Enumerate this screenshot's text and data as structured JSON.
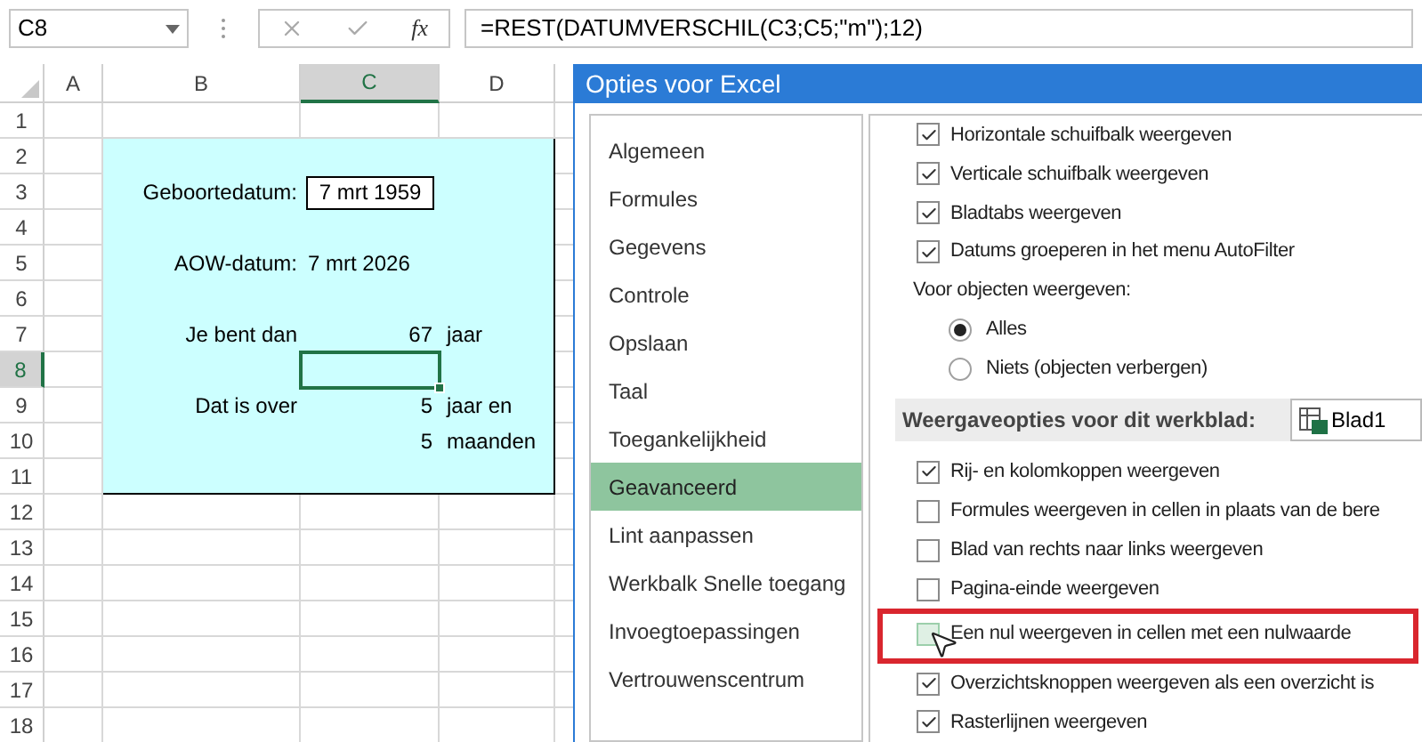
{
  "formula_bar": {
    "name_box": "C8",
    "function_button": "fx",
    "formula": "=REST(DATUMVERSCHIL(C3;C5;\"m\");12)"
  },
  "sheet": {
    "columns": [
      {
        "label": "A",
        "selected": false
      },
      {
        "label": "B",
        "selected": false
      },
      {
        "label": "C",
        "selected": true
      },
      {
        "label": "D",
        "selected": false
      }
    ],
    "rows": [
      {
        "header": "1",
        "selected": false,
        "cells": {}
      },
      {
        "header": "2",
        "selected": false,
        "cells": {}
      },
      {
        "header": "3",
        "selected": false,
        "cells": {
          "B": {
            "text": "Geboortedatum:",
            "kind": "label"
          },
          "C": {
            "text": "7 mrt 1959",
            "kind": "date",
            "boxed": true
          }
        }
      },
      {
        "header": "4",
        "selected": false,
        "cells": {}
      },
      {
        "header": "5",
        "selected": false,
        "cells": {
          "B": {
            "text": "AOW-datum:",
            "kind": "label"
          },
          "C": {
            "text": "7 mrt 2026",
            "kind": "date",
            "boxed": false
          }
        }
      },
      {
        "header": "6",
        "selected": false,
        "cells": {}
      },
      {
        "header": "7",
        "selected": false,
        "cells": {
          "B": {
            "text": "Je bent dan",
            "kind": "label"
          },
          "C": {
            "text": "67",
            "kind": "number"
          },
          "D": {
            "text": "jaar",
            "kind": "unit"
          }
        }
      },
      {
        "header": "8",
        "selected": true,
        "cells": {}
      },
      {
        "header": "9",
        "selected": false,
        "cells": {
          "B": {
            "text": "Dat is over",
            "kind": "label"
          },
          "C": {
            "text": "5",
            "kind": "number"
          },
          "D": {
            "text": "jaar en",
            "kind": "unit"
          }
        }
      },
      {
        "header": "10",
        "selected": false,
        "cells": {
          "C": {
            "text": "5",
            "kind": "number"
          },
          "D": {
            "text": "maanden",
            "kind": "unit"
          }
        }
      },
      {
        "header": "11",
        "selected": false,
        "cells": {}
      },
      {
        "header": "12",
        "selected": false,
        "cells": {}
      },
      {
        "header": "13",
        "selected": false,
        "cells": {}
      },
      {
        "header": "14",
        "selected": false,
        "cells": {}
      },
      {
        "header": "15",
        "selected": false,
        "cells": {}
      },
      {
        "header": "16",
        "selected": false,
        "cells": {}
      },
      {
        "header": "17",
        "selected": false,
        "cells": {}
      },
      {
        "header": "18",
        "selected": false,
        "cells": {}
      }
    ]
  },
  "dialog": {
    "title": "Opties voor Excel",
    "nav_items": [
      {
        "label": "Algemeen",
        "selected": false
      },
      {
        "label": "Formules",
        "selected": false
      },
      {
        "label": "Gegevens",
        "selected": false
      },
      {
        "label": "Controle",
        "selected": false
      },
      {
        "label": "Opslaan",
        "selected": false
      },
      {
        "label": "Taal",
        "selected": false
      },
      {
        "label": "Toegankelijkheid",
        "selected": false
      },
      {
        "label": "Geavanceerd",
        "selected": true
      },
      {
        "label": "Lint aanpassen",
        "selected": false
      },
      {
        "label": "Werkbalk Snelle toegang",
        "selected": false
      },
      {
        "label": "Invoegtoepassingen",
        "selected": false
      },
      {
        "label": "Vertrouwenscentrum",
        "selected": false
      }
    ],
    "options": [
      {
        "kind": "checkbox",
        "label": "Horizontale schuifbalk weergeven",
        "checked": true
      },
      {
        "kind": "checkbox",
        "label": "Verticale schuifbalk weergeven",
        "checked": true
      },
      {
        "kind": "checkbox",
        "label": "Bladtabs weergeven",
        "checked": true
      },
      {
        "kind": "checkbox",
        "label": "Datums groeperen in het menu AutoFilter",
        "checked": true
      },
      {
        "kind": "label",
        "label": "Voor objecten weergeven:"
      },
      {
        "kind": "radio",
        "label": "Alles",
        "selected": true
      },
      {
        "kind": "radio",
        "label": "Niets (objecten verbergen)",
        "selected": false
      },
      {
        "kind": "section",
        "label": "Weergaveopties voor dit werkblad:",
        "value": "Blad1"
      },
      {
        "kind": "checkbox",
        "label": "Rij- en kolomkoppen weergeven",
        "checked": true
      },
      {
        "kind": "checkbox",
        "label": "Formules weergeven in cellen in plaats van de bere",
        "checked": false
      },
      {
        "kind": "checkbox",
        "label": "Blad van rechts naar links weergeven",
        "checked": false
      },
      {
        "kind": "checkbox",
        "label": "Pagina-einde weergeven",
        "checked": false
      },
      {
        "kind": "checkbox",
        "label": "Een nul weergeven in cellen met een nulwaarde",
        "checked": false,
        "hovered": true,
        "highlighted": true
      },
      {
        "kind": "checkbox",
        "label": "Overzichtsknoppen weergeven als een overzicht is",
        "checked": true
      },
      {
        "kind": "checkbox",
        "label": "Rasterlijnen weergeven",
        "checked": true
      }
    ]
  }
}
